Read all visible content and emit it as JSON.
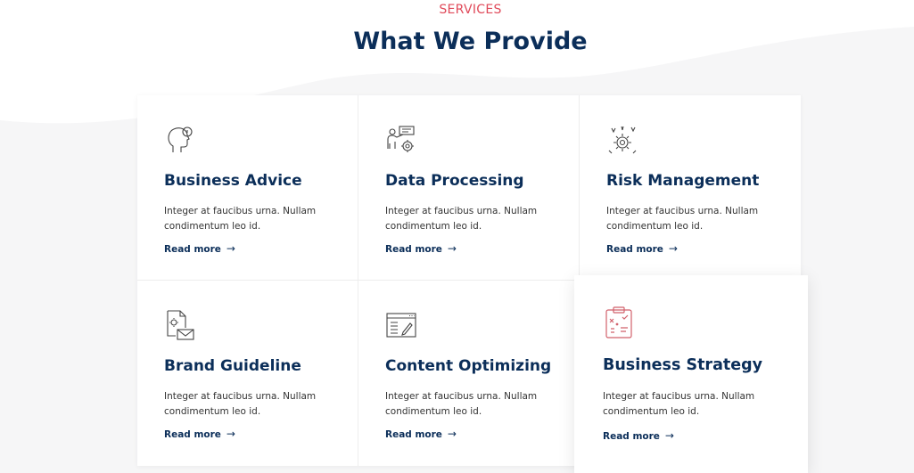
{
  "header": {
    "eyebrow": "SERVICES",
    "title": "What We Provide"
  },
  "colors": {
    "accent": "#e04a5a",
    "heading": "#0b2e59",
    "background": "#f6f6f7"
  },
  "services": [
    {
      "title": "Business Advice",
      "text": "Integer at faucibus urna. Nullam condimentum leo id.",
      "link": "Read more",
      "icon": "head-idea-icon"
    },
    {
      "title": "Data Processing",
      "text": "Integer at faucibus urna. Nullam condimentum leo id.",
      "link": "Read more",
      "icon": "presenter-data-icon"
    },
    {
      "title": "Risk Management",
      "text": "Integer at faucibus urna. Nullam condimentum leo id.",
      "link": "Read more",
      "icon": "gear-risk-icon"
    },
    {
      "title": "Brand Guideline",
      "text": "Integer at faucibus urna. Nullam condimentum leo id.",
      "link": "Read more",
      "icon": "document-mail-icon"
    },
    {
      "title": "Content Optimizing",
      "text": "Integer at faucibus urna. Nullam condimentum leo id.",
      "link": "Read more",
      "icon": "browser-edit-icon"
    },
    {
      "title": "Business Strategy",
      "text": "Integer at faucibus urna. Nullam condimentum leo id.",
      "link": "Read more",
      "icon": "clipboard-strategy-icon"
    }
  ]
}
